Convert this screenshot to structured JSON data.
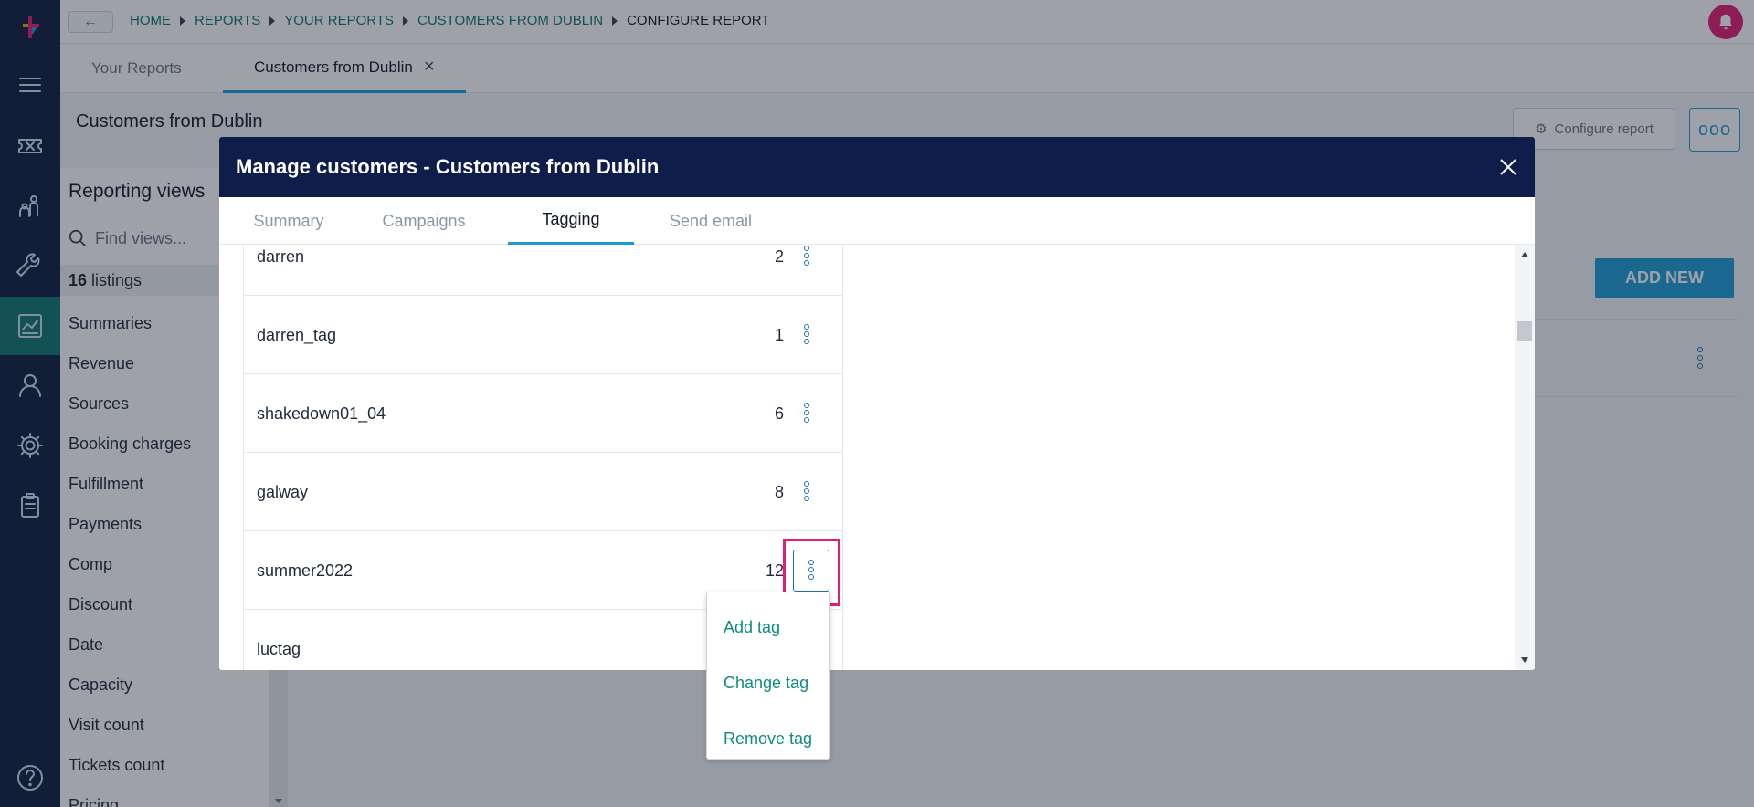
{
  "nav": {
    "items": [
      {
        "id": "logo",
        "icon": "app-logo-icon"
      },
      {
        "id": "menu",
        "icon": "hamburger-menu-icon"
      },
      {
        "id": "tickets",
        "icon": "ticket-icon"
      },
      {
        "id": "people",
        "icon": "people-icon"
      },
      {
        "id": "tools",
        "icon": "wrench-icon"
      },
      {
        "id": "reports",
        "icon": "report-chart-icon",
        "active": true
      },
      {
        "id": "user",
        "icon": "user-icon"
      },
      {
        "id": "settings",
        "icon": "gear-icon"
      },
      {
        "id": "clipboard",
        "icon": "clipboard-icon"
      },
      {
        "id": "help",
        "icon": "help-icon"
      }
    ]
  },
  "breadcrumb": {
    "items": [
      "HOME",
      "REPORTS",
      "YOUR REPORTS",
      "CUSTOMERS FROM DUBLIN"
    ],
    "current": "CONFIGURE REPORT"
  },
  "report_tabs": {
    "your_reports": "Your Reports",
    "customers": "Customers from Dublin"
  },
  "page": {
    "title": "Customers from Dublin",
    "configure_label": "Configure report",
    "more_label": "ooo"
  },
  "views": {
    "title": "Reporting views",
    "search_placeholder": "Find views...",
    "count": "16",
    "count_label": "listings",
    "items": [
      "Summaries",
      "Revenue",
      "Sources",
      "Booking charges",
      "Fulfillment",
      "Payments",
      "Comp",
      "Discount",
      "Date",
      "Capacity",
      "Visit count",
      "Tickets count",
      "Pricing"
    ]
  },
  "content": {
    "add_new": "ADD NEW"
  },
  "modal": {
    "title": "Manage customers - Customers from Dublin",
    "tabs": [
      "Summary",
      "Campaigns",
      "Tagging",
      "Send email"
    ],
    "active_tab": "Tagging",
    "tags": [
      {
        "name": "darren",
        "count": "2"
      },
      {
        "name": "darren_tag",
        "count": "1"
      },
      {
        "name": "shakedown01_04",
        "count": "6"
      },
      {
        "name": "galway",
        "count": "8"
      },
      {
        "name": "summer2022",
        "count": "12"
      },
      {
        "name": "luctag",
        "count": ""
      }
    ],
    "menu": [
      "Add tag",
      "Change tag",
      "Remove tag"
    ]
  },
  "colors": {
    "nav_bg": "#0e1d3d",
    "modal_header": "#0e1d4a",
    "accent": "#1d9bd6",
    "link_teal": "#0f8c7e",
    "highlight": "#e11d74"
  }
}
